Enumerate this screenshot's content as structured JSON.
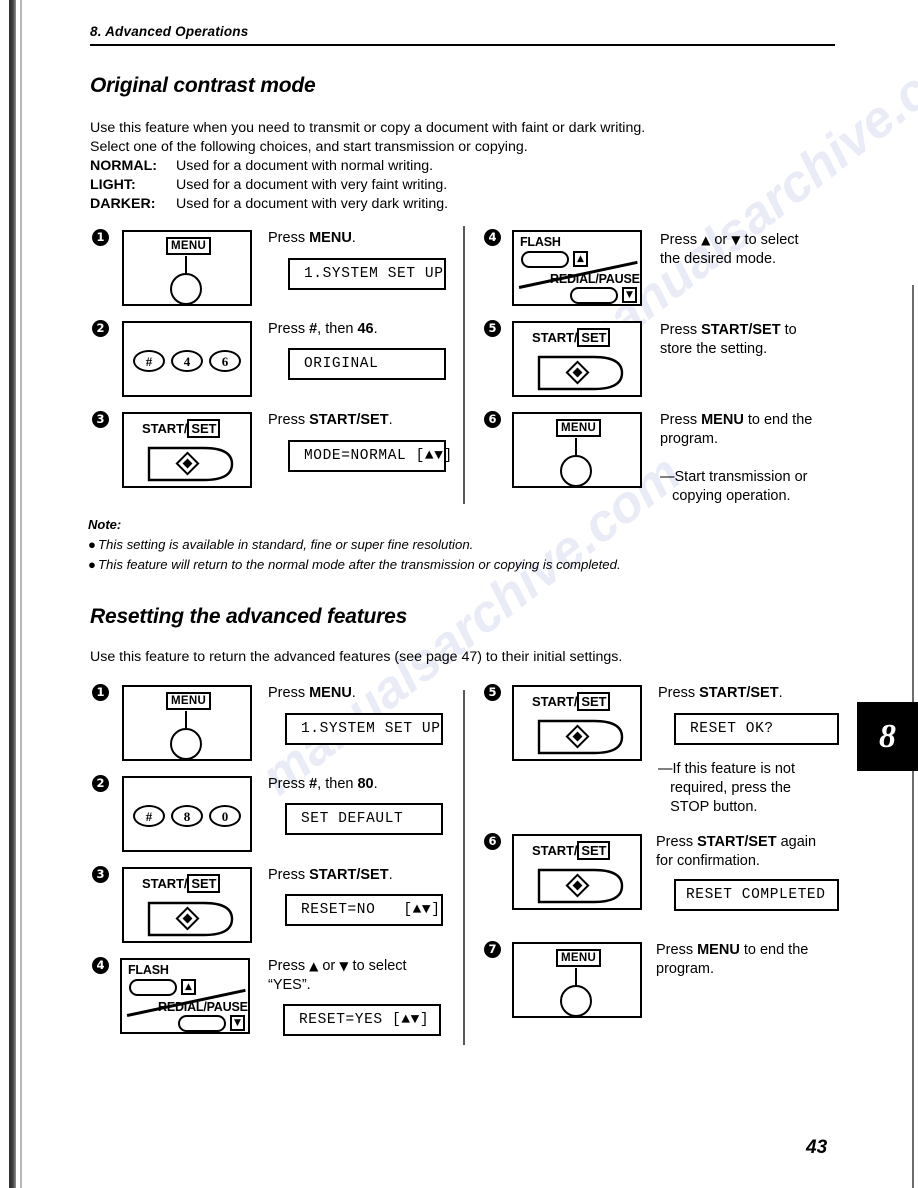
{
  "page": {
    "running_head": "8.  Advanced Operations",
    "folio": "43",
    "chapter_tab": "8",
    "watermark": "manualsarchive.com"
  },
  "sections": [
    {
      "title": "Original contrast mode",
      "intro": [
        "Use this feature when you need to transmit or copy a document with faint or dark writing.",
        "Select one of the following choices, and start transmission or copying."
      ],
      "choices": [
        {
          "term": "NORMAL:",
          "desc": "Used for a document with normal writing."
        },
        {
          "term": "LIGHT:",
          "desc": "Used for a document with very faint writing."
        },
        {
          "term": "DARKER:",
          "desc": "Used for a document with very dark writing."
        }
      ],
      "steps": [
        {
          "num": "1",
          "panel": "menu",
          "menu_label": "MENU",
          "instr_html": "Press <b>MENU</b>.",
          "lcd": "1.SYSTEM SET UP"
        },
        {
          "num": "2",
          "panel": "keypad",
          "keys": [
            "#",
            "4",
            "6"
          ],
          "instr_html": "Press <b>#</b>, then <b>46</b>.",
          "lcd": "ORIGINAL"
        },
        {
          "num": "3",
          "panel": "startset",
          "start_label": "START/",
          "set_label": "SET",
          "instr_html": "Press <b>START/SET</b>.",
          "lcd": "MODE=NORMAL [▲▼]"
        },
        {
          "num": "4",
          "panel": "flash",
          "flash_label": "FLASH",
          "redial_label": "REDIAL/PAUSE",
          "up_arrow": "▲",
          "down_arrow": "▼",
          "instr_html": "Press <span class=\"arr\">▲</span> or <span class=\"arr\">▼</span> to select<br>the desired mode.",
          "lcd": null
        },
        {
          "num": "5",
          "panel": "startset",
          "start_label": "START/",
          "set_label": "SET",
          "instr_html": "Press <b>START/SET</b> to<br>store the setting.",
          "lcd": null
        },
        {
          "num": "6",
          "panel": "menu",
          "menu_label": "MENU",
          "instr_html": "Press <b>MENU</b> to end the<br>program.<br><br>—Start transmission or<br>&nbsp;&nbsp;&nbsp;copying operation.",
          "lcd": null
        }
      ],
      "note": {
        "heading": "Note:",
        "items": [
          "This setting is available in standard, fine or super fine resolution.",
          "This feature will return to the normal mode after the transmission or copying is completed."
        ]
      }
    },
    {
      "title": "Resetting the advanced features",
      "intro": [
        "Use this feature to return the advanced features (see page 47) to their initial settings."
      ],
      "choices": [],
      "steps": [
        {
          "num": "1",
          "panel": "menu",
          "menu_label": "MENU",
          "instr_html": "Press <b>MENU</b>.",
          "lcd": "1.SYSTEM SET UP"
        },
        {
          "num": "2",
          "panel": "keypad",
          "keys": [
            "#",
            "8",
            "0"
          ],
          "instr_html": "Press <b>#</b>, then <b>80</b>.",
          "lcd": "SET DEFAULT"
        },
        {
          "num": "3",
          "panel": "startset",
          "start_label": "START/",
          "set_label": "SET",
          "instr_html": "Press <b>START/SET</b>.",
          "lcd": "RESET=NO   [▲▼]"
        },
        {
          "num": "4",
          "panel": "flash",
          "flash_label": "FLASH",
          "redial_label": "REDIAL/PAUSE",
          "up_arrow": "▲",
          "down_arrow": "▼",
          "instr_html": "Press <span class=\"arr\">▲</span> or <span class=\"arr\">▼</span> to select<br>“YES”.",
          "lcd": "RESET=YES [▲▼]"
        },
        {
          "num": "5",
          "panel": "startset",
          "start_label": "START/",
          "set_label": "SET",
          "instr_html": "Press <b>START/SET</b>.",
          "lcd": "RESET OK?",
          "extra_html": "—If this feature is not<br>&nbsp;&nbsp;&nbsp;required, press the<br>&nbsp;&nbsp;&nbsp;STOP button."
        },
        {
          "num": "6",
          "panel": "startset",
          "start_label": "START/",
          "set_label": "SET",
          "instr_html": "Press <b>START/SET</b> again<br>for confirmation.",
          "lcd": "RESET COMPLETED"
        },
        {
          "num": "7",
          "panel": "menu",
          "menu_label": "MENU",
          "instr_html": "Press <b>MENU</b> to end the<br>program.",
          "lcd": null
        }
      ],
      "note": null
    }
  ]
}
